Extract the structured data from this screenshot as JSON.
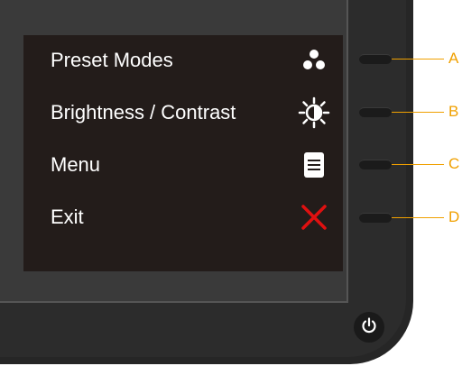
{
  "osd": {
    "items": [
      {
        "label": "Preset Modes",
        "icon": "three-dots-icon"
      },
      {
        "label": "Brightness / Contrast",
        "icon": "brightness-contrast-icon"
      },
      {
        "label": "Menu",
        "icon": "menu-icon"
      },
      {
        "label": "Exit",
        "icon": "close-x-icon"
      }
    ]
  },
  "buttons": [
    {
      "letter": "A"
    },
    {
      "letter": "B"
    },
    {
      "letter": "C"
    },
    {
      "letter": "D"
    }
  ],
  "power": {
    "icon": "power-icon"
  },
  "colors": {
    "accent": "#f0a000",
    "exit": "#e01010",
    "osd_bg": "#231c1a"
  }
}
